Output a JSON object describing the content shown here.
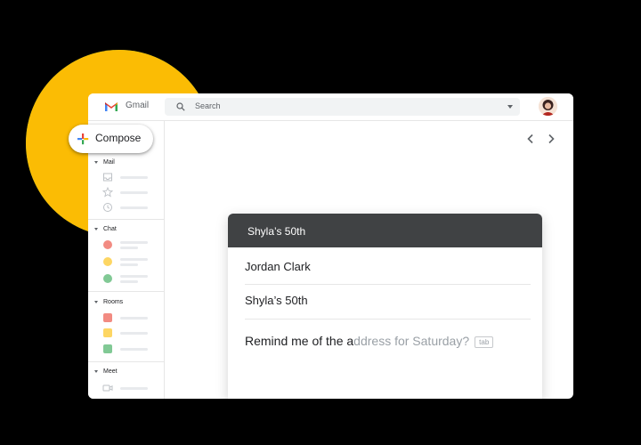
{
  "colors": {
    "background": "#000000",
    "green": "#34a853",
    "yellow": "#fbbc04",
    "header_dark": "#404244",
    "ghost_text": "#9aa0a6"
  },
  "topbar": {
    "app_name": "Gmail",
    "logo_icon": "gmail-logo-icon",
    "search_placeholder": "Search",
    "search_icon": "search-icon",
    "account_icon": "avatar"
  },
  "compose": {
    "label": "Compose",
    "icon": "plus-icon"
  },
  "sidebar": {
    "mail": {
      "title": "Mail",
      "items": [
        {
          "icon": "inbox-icon"
        },
        {
          "icon": "star-icon"
        },
        {
          "icon": "clock-icon"
        }
      ]
    },
    "chat": {
      "title": "Chat",
      "items": [
        {
          "icon": "contact-red-icon",
          "color": "#f28b82"
        },
        {
          "icon": "contact-yellow-icon",
          "color": "#fdd663"
        },
        {
          "icon": "contact-green-icon",
          "color": "#81c995"
        }
      ]
    },
    "rooms": {
      "title": "Rooms",
      "items": [
        {
          "icon": "room-red-icon",
          "color": "#f28b82"
        },
        {
          "icon": "room-yellow-icon",
          "color": "#fdd663"
        },
        {
          "icon": "room-green-icon",
          "color": "#81c995"
        }
      ]
    },
    "meet": {
      "title": "Meet",
      "items": [
        {
          "icon": "video-icon"
        }
      ]
    }
  },
  "navigation": {
    "prev_icon": "chevron-left-icon",
    "next_icon": "chevron-right-icon"
  },
  "compose_window": {
    "title": "Shyla’s 50th",
    "to": "Jordan Clark",
    "subject": "Shyla’s 50th",
    "body_typed": "Remind me of the a",
    "body_suggestion": "ddress for Saturday?",
    "tab_hint": "tab"
  }
}
